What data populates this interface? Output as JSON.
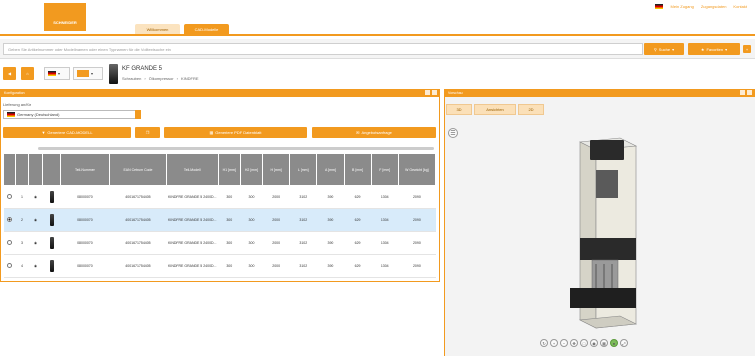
{
  "header": {
    "logo_text": "SCHNEIDER",
    "my_account": "Mein Zugang",
    "access_data": "Zugangsdaten",
    "contact": "Kontakt",
    "tabs": [
      "Willkommen",
      "CAD-Modelle"
    ]
  },
  "search": {
    "placeholder": "Geben Sie Artikelnummer oder Modellnamen oder einen Typnamen für die Volltextsuche ein",
    "search_label": "Suche",
    "favorites_label": "Favoriten"
  },
  "product": {
    "title": "KF GRANDE 5",
    "breadcrumb": [
      "Schrauben",
      "Ölkompressor",
      "KINDFRE"
    ]
  },
  "left_panel": {
    "title": "Konfiguration",
    "delivery_label": "Lieferung an/für",
    "delivery_value": "Germany (Deutschland)",
    "buttons": [
      "Generiere CAD-MODELL",
      "",
      "Generiere PDF Datenblatt",
      "Angebotsanfrage"
    ]
  },
  "table": {
    "headers": [
      "",
      "",
      "",
      "",
      "Teil-Nummer",
      "EAN Cetrum Code",
      "Teil-Modell",
      "H1 [mm]",
      "H2 [mm]",
      "H [mm]",
      "L [mm]",
      "A [mm]",
      "B [mm]",
      "F [mm]",
      "W Gewicht [kg]"
    ],
    "rows": [
      [
        "1",
        "08000070",
        "4001671754405",
        "KINDFRE GRANDE 5 2400D...",
        "300",
        "300",
        "2000",
        "3102",
        "390",
        "629",
        "1304",
        "2090"
      ],
      [
        "2",
        "08000070",
        "4001671754405",
        "KINDFRE GRANDE 5 2400D...",
        "300",
        "300",
        "2000",
        "3102",
        "390",
        "629",
        "1304",
        "2090"
      ],
      [
        "3",
        "08000070",
        "4001671754405",
        "KINDFRE GRANDE 5 2400D...",
        "300",
        "300",
        "2000",
        "3102",
        "390",
        "629",
        "1304",
        "2090"
      ],
      [
        "4",
        "08000070",
        "4001671754405",
        "KINDFRE GRANDE 5 2400D...",
        "300",
        "300",
        "2000",
        "3102",
        "390",
        "629",
        "1304",
        "2090"
      ]
    ],
    "selected_row": 2
  },
  "right_panel": {
    "title": "Vorschau",
    "tabs": [
      "3D",
      "Ansichten",
      "2D"
    ]
  },
  "colors": {
    "accent": "#f29a1f",
    "header_gray": "#8b8b8b",
    "selected_row": "#d8ebfa"
  }
}
